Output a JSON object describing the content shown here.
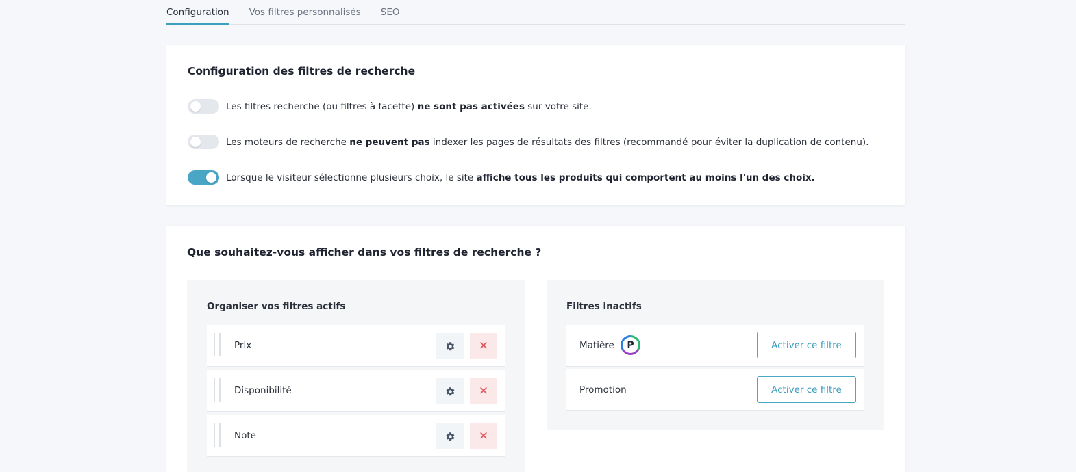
{
  "tabs": [
    {
      "label": "Configuration",
      "active": true
    },
    {
      "label": "Vos filtres personnalisés",
      "active": false
    },
    {
      "label": "SEO",
      "active": false
    }
  ],
  "config": {
    "title": "Configuration des filtres de recherche",
    "options": [
      {
        "enabled": false,
        "text_before": "Les filtres recherche (ou filtres à facette) ",
        "text_bold": "ne sont pas activées",
        "text_after": " sur votre site."
      },
      {
        "enabled": false,
        "text_before": "Les moteurs de recherche ",
        "text_bold": "ne peuvent pas",
        "text_after": " indexer les pages de résultats des filtres (recommandé pour éviter la duplication de contenu)."
      },
      {
        "enabled": true,
        "text_before": "Lorsque le visiteur sélectionne plusieurs choix, le site ",
        "text_bold": "affiche tous les produits qui comportent au moins l'un des choix.",
        "text_after": ""
      }
    ]
  },
  "display": {
    "title": "Que souhaitez-vous afficher dans vos filtres de recherche ?",
    "active_panel": {
      "title": "Organiser vos filtres actifs",
      "filters": [
        "Prix",
        "Disponibilité",
        "Note"
      ],
      "delete_glyph": "✕"
    },
    "inactive_panel": {
      "title": "Filtres inactifs",
      "filters": [
        {
          "label": "Matière",
          "badge": "P"
        },
        {
          "label": "Promotion",
          "badge": ""
        }
      ],
      "activate_label": "Activer ce filtre"
    }
  },
  "colors": {
    "accent": "#49a6c4",
    "danger": "#e05259",
    "toggle_off": "#e4e7ec"
  }
}
